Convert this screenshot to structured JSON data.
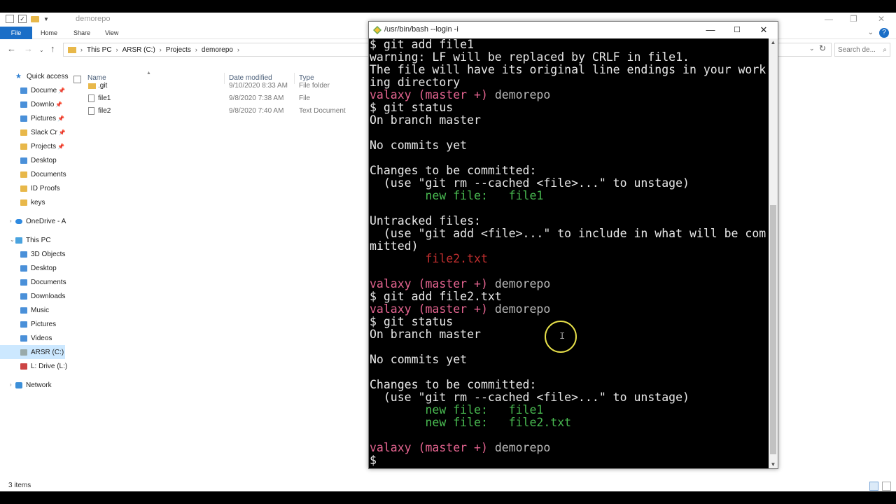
{
  "explorer": {
    "title": "demorepo",
    "ribbon_tabs": [
      "File",
      "Home",
      "Share",
      "View"
    ],
    "breadcrumb": [
      "This PC",
      "ARSR (C:)",
      "Projects",
      "demorepo"
    ],
    "search_placeholder": "Search de...",
    "sidebar": {
      "quick_access": "Quick access",
      "pinned": [
        "Docume",
        "Downlo",
        "Pictures",
        "Slack Cr",
        "Projects"
      ],
      "recent": [
        "Desktop",
        "Documents",
        "ID Proofs",
        "keys"
      ],
      "onedrive": "OneDrive - A",
      "this_pc": "This PC",
      "pc_items": [
        "3D Objects",
        "Desktop",
        "Documents",
        "Downloads",
        "Music",
        "Pictures",
        "Videos",
        "ARSR (C:)",
        "L: Drive (L:)"
      ],
      "network": "Network"
    },
    "columns": {
      "name": "Name",
      "date": "Date modified",
      "type": "Type"
    },
    "files": [
      {
        "name": ".git",
        "date": "9/10/2020 8:33 AM",
        "type": "File folder",
        "icon": "folder-icon"
      },
      {
        "name": "file1",
        "date": "9/8/2020 7:38 AM",
        "type": "File",
        "icon": "file-icon"
      },
      {
        "name": "file2",
        "date": "9/8/2020 7:40 AM",
        "type": "Text Document",
        "icon": "text-file-icon"
      }
    ],
    "status": "3 items"
  },
  "terminal": {
    "title": "/usr/bin/bash --login -i",
    "lines": [
      [
        [
          "$ git add file1",
          "w"
        ]
      ],
      [
        [
          "warning: LF will be replaced by CRLF in file1.",
          "w"
        ]
      ],
      [
        [
          "The file will have its original line endings in your work",
          "w"
        ]
      ],
      [
        [
          "ing directory",
          "w"
        ]
      ],
      [
        [
          "valaxy ",
          "m"
        ],
        [
          "(master +)",
          "m"
        ],
        [
          " demorepo",
          "p"
        ]
      ],
      [
        [
          "$ git status",
          "w"
        ]
      ],
      [
        [
          "On branch master",
          "w"
        ]
      ],
      [
        [
          "",
          "w"
        ]
      ],
      [
        [
          "No commits yet",
          "w"
        ]
      ],
      [
        [
          "",
          "w"
        ]
      ],
      [
        [
          "Changes to be committed:",
          "w"
        ]
      ],
      [
        [
          "  (use \"git rm --cached <file>...\" to unstage)",
          "w"
        ]
      ],
      [
        [
          "        new file:   file1",
          "g"
        ]
      ],
      [
        [
          "",
          "w"
        ]
      ],
      [
        [
          "Untracked files:",
          "w"
        ]
      ],
      [
        [
          "  (use \"git add <file>...\" to include in what will be com",
          "w"
        ]
      ],
      [
        [
          "mitted)",
          "w"
        ]
      ],
      [
        [
          "        file2.txt",
          "r"
        ]
      ],
      [
        [
          "",
          "w"
        ]
      ],
      [
        [
          "valaxy ",
          "m"
        ],
        [
          "(master +)",
          "m"
        ],
        [
          " demorepo",
          "p"
        ]
      ],
      [
        [
          "$ git add file2.txt",
          "w"
        ]
      ],
      [
        [
          "valaxy ",
          "m"
        ],
        [
          "(master +)",
          "m"
        ],
        [
          " demorepo",
          "p"
        ]
      ],
      [
        [
          "$ git status",
          "w"
        ]
      ],
      [
        [
          "On branch master",
          "w"
        ]
      ],
      [
        [
          "",
          "w"
        ]
      ],
      [
        [
          "No commits yet",
          "w"
        ]
      ],
      [
        [
          "",
          "w"
        ]
      ],
      [
        [
          "Changes to be committed:",
          "w"
        ]
      ],
      [
        [
          "  (use \"git rm --cached <file>...\" to unstage)",
          "w"
        ]
      ],
      [
        [
          "        new file:   file1",
          "g"
        ]
      ],
      [
        [
          "        new file:   file2.txt",
          "g"
        ]
      ],
      [
        [
          "",
          "w"
        ]
      ],
      [
        [
          "valaxy ",
          "m"
        ],
        [
          "(master +)",
          "m"
        ],
        [
          " demorepo",
          "p"
        ]
      ],
      [
        [
          "$",
          "w"
        ]
      ]
    ]
  },
  "colors": {
    "prompt_user": "#e56490",
    "staged": "#48b850",
    "untracked": "#c02e2e",
    "file_tab": "#1a6ec7"
  }
}
